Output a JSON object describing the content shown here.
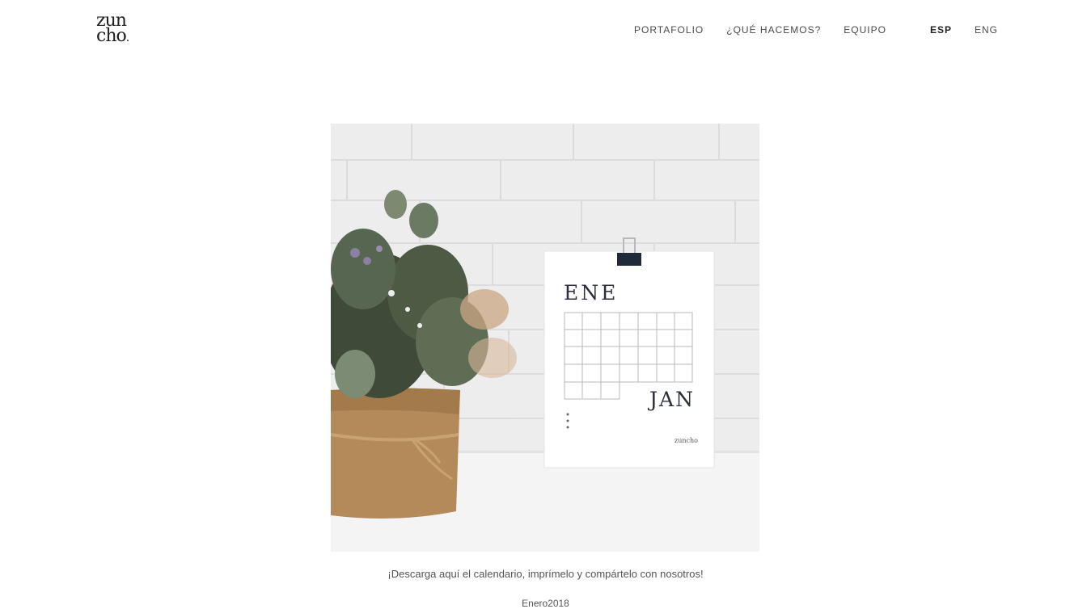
{
  "brand": {
    "logo_line1": "zun",
    "logo_line2": "cho",
    "logo_dot": "."
  },
  "nav": {
    "items": [
      "PORTAFOLIO",
      "¿QUÉ HACEMOS?",
      "EQUIPO"
    ]
  },
  "lang": {
    "esp": "ESP",
    "eng": "ENG",
    "active": "ESP"
  },
  "hero": {
    "month_es": "ENE",
    "month_en": "JAN",
    "brand_small": "zuncho",
    "colors": {
      "wall": "#eeedee",
      "table": "#f5f4f5",
      "burlap": "#b58a5a",
      "foliage": "#3f4a38"
    }
  },
  "content": {
    "caption": "¡Descarga aquí el calendario, imprímelo y compártelo con nosotros!",
    "subtitle": "Enero2018"
  }
}
